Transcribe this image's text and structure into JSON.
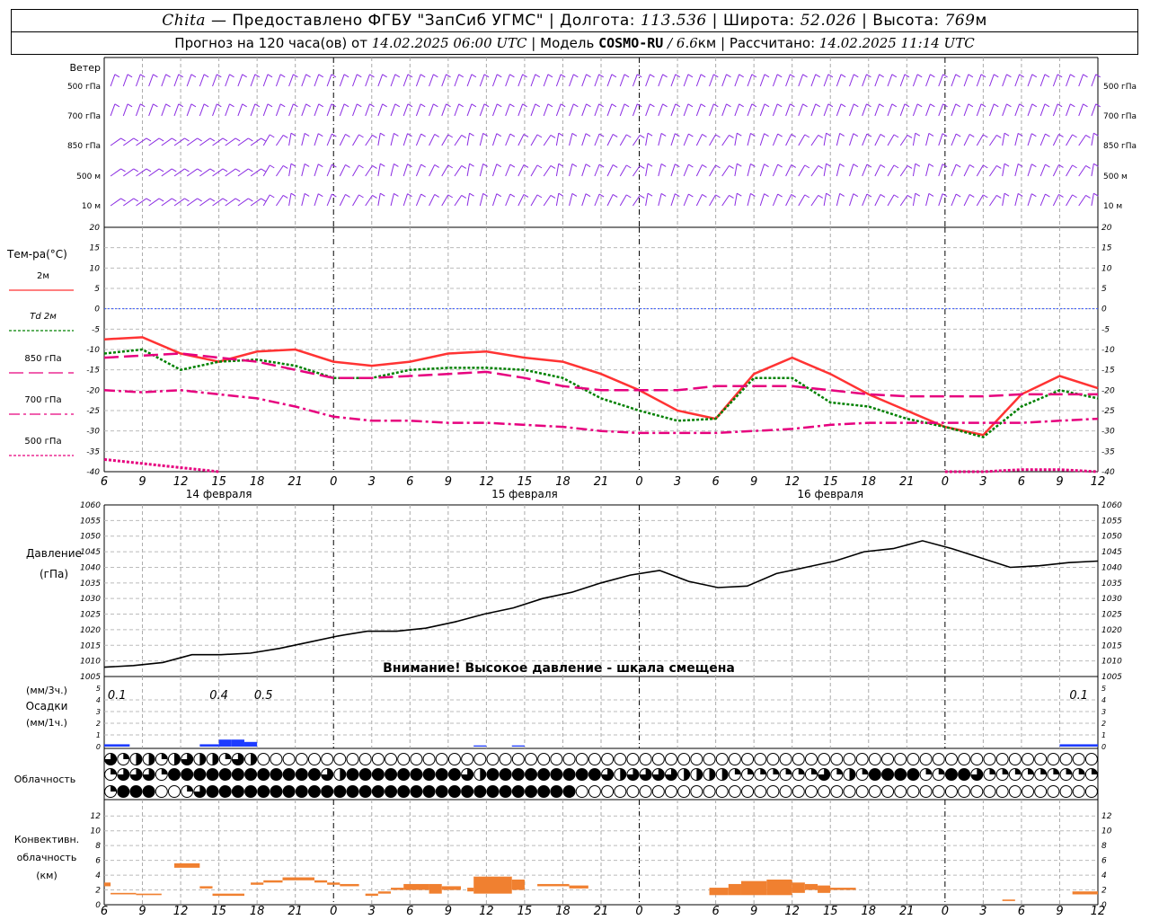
{
  "header": {
    "station": "Chita",
    "dash": "—",
    "provider": "Предоставлено ФГБУ \"ЗапСиб УГМС\"",
    "lon_label": "Долгота:",
    "lon": "113.536",
    "lat_label": "Широта:",
    "lat": "52.026",
    "alt_label": "Высота:",
    "alt": "769",
    "alt_unit": "м",
    "forecast_label": "Прогноз на 120 часа(ов) от",
    "run_time": "14.02.2025 06:00 UTC",
    "model_label": "Модель",
    "model": "COSMO-RU",
    "model_res": "/ 6.6",
    "model_res_unit": "км",
    "calc_label": "Рассчитано:",
    "calc_time": "14.02.2025 11:14 UTC",
    "sep": "|"
  },
  "panel_labels": {
    "wind": "Ветер",
    "wind_levels": [
      "500 гПа",
      "700 гПа",
      "850 гПа",
      "500 м",
      "10  м"
    ],
    "temp_title": "Тем-ра(°С)",
    "temp_legend": [
      "2м",
      "Td  2м",
      "850 гПа",
      "700 гПа",
      "500 гПа"
    ],
    "pressure_title": "Давление",
    "pressure_unit": "(гПа)",
    "pressure_warning": "Внимание! Высокое давление - шкала смещена",
    "precip_unit_top": "(мм/3ч.)",
    "precip_title": "Осадки",
    "precip_unit_bottom": "(мм/1ч.)",
    "cloud_title": "Облачность",
    "conv_title_1": "Конвективн.",
    "conv_title_2": "облачность",
    "conv_unit": "(км)"
  },
  "colors": {
    "t2m": "#ff3333",
    "td2m": "#008000",
    "t850": "#e6007e",
    "t700": "#e6007e",
    "t500": "#e6007e",
    "wind": "#8a2be2",
    "precip": "#1e3cff",
    "conv": "#f08030",
    "zero_line": "#3355ff"
  },
  "chart_data": [
    {
      "type": "line",
      "title": "Тем-ра(°С)",
      "x_ticks": [
        "6",
        "9",
        "12",
        "15",
        "18",
        "21",
        "0",
        "3",
        "6",
        "9",
        "12",
        "15",
        "18",
        "21",
        "0",
        "3",
        "6",
        "9",
        "12",
        "15",
        "18",
        "21",
        "0",
        "3",
        "6",
        "9",
        "12"
      ],
      "dates": [
        "14 февраля",
        "15 февраля",
        "16 февраля"
      ],
      "ylim": [
        -40,
        20
      ],
      "y_ticks": [
        20,
        15,
        10,
        5,
        0,
        -5,
        -10,
        -15,
        -20,
        -25,
        -30,
        -35,
        -40
      ],
      "x_hours": [
        0,
        3,
        6,
        9,
        12,
        15,
        18,
        21,
        24,
        27,
        30,
        33,
        36,
        39,
        42,
        45,
        48,
        51,
        54,
        57,
        60,
        63,
        66,
        69,
        72,
        75,
        78
      ],
      "series": [
        {
          "name": "2м",
          "values": [
            -7.5,
            -7,
            -11,
            -13,
            -10.5,
            -10,
            -13,
            -14,
            -13,
            -11,
            -10.5,
            -12,
            -13,
            -16,
            -20,
            -25,
            -27,
            -16,
            -12,
            -16,
            -21,
            -25,
            -29,
            -31,
            -21,
            -16.5,
            -19.5
          ]
        },
        {
          "name": "Td  2м",
          "values": [
            -11,
            -10,
            -15,
            -13,
            -12.5,
            -14,
            -17,
            -17,
            -15,
            -14.5,
            -14.5,
            -15,
            -17,
            -22,
            -25,
            -27.5,
            -27,
            -17,
            -17,
            -23,
            -24,
            -27,
            -29,
            -31.5,
            -24,
            -20,
            -22
          ]
        },
        {
          "name": "850 гПа",
          "values": [
            -12,
            -11.5,
            -11,
            -12,
            -13,
            -15,
            -17,
            -17,
            -16.5,
            -16,
            -15.5,
            -17,
            -19,
            -20,
            -20,
            -20,
            -19,
            -19,
            -19,
            -20,
            -21,
            -21.5,
            -21.5,
            -21.5,
            -21,
            -21,
            -21
          ]
        },
        {
          "name": "700 гПа",
          "values": [
            -20,
            -20.5,
            -20,
            -21,
            -22,
            -24,
            -26.5,
            -27.5,
            -27.5,
            -28,
            -28,
            -28.5,
            -29,
            -30,
            -30.5,
            -30.5,
            -30.5,
            -30,
            -29.5,
            -28.5,
            -28,
            -28,
            -28,
            -28,
            -28,
            -27.5,
            -27
          ]
        },
        {
          "name": "500 гПа",
          "values": [
            -37,
            -38,
            -39,
            -40,
            null,
            null,
            null,
            null,
            null,
            null,
            null,
            null,
            null,
            null,
            null,
            null,
            null,
            null,
            null,
            null,
            null,
            null,
            -40,
            -40,
            -39.5,
            -39.5,
            -40
          ]
        }
      ]
    },
    {
      "type": "line",
      "title": "Давление",
      "ylabel": "(гПа)",
      "ylim": [
        1005,
        1060
      ],
      "y_ticks": [
        1060,
        1055,
        1050,
        1045,
        1040,
        1035,
        1030,
        1025,
        1020,
        1015,
        1010,
        1005
      ],
      "x_hours": [
        0,
        3,
        6,
        9,
        12,
        15,
        18,
        21,
        24,
        27,
        30,
        33,
        36,
        39,
        42,
        45,
        48,
        51,
        54,
        57,
        60,
        63,
        66,
        69,
        72,
        75,
        78
      ],
      "series": [
        {
          "name": "pressure",
          "values": [
            1008,
            1008.5,
            1009.5,
            1012,
            1012,
            1012.5,
            1014,
            1016,
            1018,
            1019.5,
            1019.5,
            1020.5,
            1022.5,
            1025,
            1027,
            1030,
            1032,
            1035,
            1037.5,
            1039,
            1035.5,
            1033.5,
            1034,
            1038,
            1040,
            1042,
            1045,
            1046,
            1048.5,
            1046,
            1043,
            1040,
            1040.5,
            1041.5,
            1042
          ]
        }
      ]
    },
    {
      "type": "bar",
      "title": "Осадки",
      "ylim": [
        0,
        5
      ],
      "y_ticks": [
        5,
        4,
        3,
        2,
        1,
        0
      ],
      "labels": [
        "0.1",
        "0.4",
        "0.5",
        "0.1"
      ],
      "bars_hours": [
        [
          0,
          2,
          0.2
        ],
        [
          7.5,
          9,
          0.2
        ],
        [
          9,
          10,
          0.6
        ],
        [
          10,
          11,
          0.6
        ],
        [
          11,
          12,
          0.4
        ],
        [
          29,
          30,
          0.1
        ],
        [
          32,
          33,
          0.1
        ],
        [
          75,
          78,
          0.2
        ]
      ]
    },
    {
      "type": "bar",
      "title": "Конвективн. облачность",
      "ylabel": "(км)",
      "ylim": [
        0,
        13
      ],
      "y_ticks": [
        12,
        10,
        8,
        6,
        4,
        2,
        0
      ],
      "bars_hours": [
        [
          0,
          0.5,
          2.5,
          3
        ],
        [
          0.5,
          2.5,
          1.4,
          1.6
        ],
        [
          2.5,
          4.5,
          1.3,
          1.5
        ],
        [
          5.5,
          7.5,
          5,
          5.6
        ],
        [
          7.5,
          8.5,
          2.2,
          2.5
        ],
        [
          8.5,
          11,
          1.2,
          1.5
        ],
        [
          11.5,
          12.5,
          2.7,
          3
        ],
        [
          12.5,
          14,
          3,
          3.3
        ],
        [
          14,
          16.5,
          3.3,
          3.7
        ],
        [
          16.5,
          17.5,
          3,
          3.3
        ],
        [
          17.5,
          18.5,
          2.7,
          3
        ],
        [
          18.5,
          20,
          2.5,
          2.8
        ],
        [
          20.5,
          21.5,
          1.2,
          1.5
        ],
        [
          21.5,
          22.5,
          1.5,
          1.8
        ],
        [
          22.5,
          23.5,
          2,
          2.3
        ],
        [
          23.5,
          25.5,
          2,
          2.8
        ],
        [
          25.5,
          26.5,
          1.5,
          2.8
        ],
        [
          26.5,
          28,
          2,
          2.5
        ],
        [
          28.5,
          29,
          1.8,
          2.3
        ],
        [
          29,
          32,
          1.5,
          3.8
        ],
        [
          32,
          33,
          2,
          3.4
        ],
        [
          34,
          36.5,
          2.5,
          2.8
        ],
        [
          36.5,
          38,
          2.2,
          2.6
        ],
        [
          47.5,
          49,
          1.3,
          2.3
        ],
        [
          49,
          50,
          1.3,
          2.8
        ],
        [
          50,
          52,
          1.3,
          3.2
        ],
        [
          52,
          54,
          1.3,
          3.4
        ],
        [
          54,
          55,
          1.6,
          3
        ],
        [
          55,
          56,
          2,
          2.8
        ],
        [
          56,
          57,
          1.6,
          2.6
        ],
        [
          57,
          59,
          2,
          2.3
        ],
        [
          70.5,
          71.5,
          0.5,
          0.7
        ],
        [
          76,
          78,
          1.4,
          1.8
        ]
      ]
    },
    {
      "type": "table",
      "title": "Облачность",
      "levels": [
        "high",
        "mid",
        "low"
      ],
      "rows": [
        [
          3,
          1,
          2,
          2,
          1,
          2,
          3,
          2,
          2,
          1,
          3,
          2,
          0,
          0,
          0,
          0,
          0,
          0,
          0,
          0,
          0,
          0,
          0,
          0,
          0,
          0,
          0,
          0,
          0,
          0,
          0,
          0,
          0,
          0,
          0,
          0,
          0,
          0,
          0,
          0,
          0,
          0,
          0,
          0,
          0,
          0,
          0,
          0,
          0,
          0,
          0,
          0,
          0,
          0,
          0,
          0,
          0,
          0,
          0,
          0,
          0,
          0,
          0,
          0,
          0,
          0,
          0,
          0,
          0,
          0,
          0,
          0,
          0,
          0,
          0,
          0,
          0,
          0,
          0
        ],
        [
          1,
          3,
          3,
          3,
          1,
          4,
          4,
          4,
          4,
          4,
          4,
          4,
          4,
          4,
          4,
          4,
          4,
          3,
          2,
          4,
          4,
          4,
          4,
          4,
          4,
          4,
          4,
          4,
          3,
          2,
          4,
          4,
          4,
          4,
          4,
          4,
          4,
          4,
          4,
          3,
          2,
          3,
          3,
          3,
          3,
          2,
          2,
          2,
          2,
          1,
          1,
          1,
          1,
          1,
          1,
          1,
          3,
          1,
          2,
          1,
          4,
          4,
          4,
          4,
          1,
          1,
          4,
          4,
          3,
          1,
          1,
          1,
          1,
          1,
          1,
          1,
          1,
          1,
          0,
          0,
          0,
          0,
          0,
          0,
          0,
          0,
          0,
          0,
          0,
          0,
          0,
          0,
          0,
          0
        ],
        [
          1,
          4,
          4,
          4,
          0,
          0,
          1,
          3,
          4,
          4,
          4,
          4,
          4,
          4,
          4,
          4,
          4,
          4,
          4,
          4,
          4,
          4,
          4,
          4,
          4,
          4,
          4,
          4,
          4,
          4,
          4,
          4,
          4,
          4,
          4,
          4,
          4,
          0,
          0,
          0,
          0,
          0,
          0,
          0,
          0,
          0,
          0,
          0,
          0,
          0,
          0,
          0,
          0,
          0,
          0,
          0,
          0,
          0,
          0,
          0,
          0,
          0,
          0,
          0,
          0,
          0,
          0,
          0,
          0,
          0,
          0,
          0,
          0,
          0,
          0,
          0,
          0,
          0,
          0,
          0,
          0,
          0,
          0,
          0,
          0,
          0,
          0,
          0,
          0,
          0,
          0,
          0,
          0,
          0
        ]
      ]
    }
  ]
}
